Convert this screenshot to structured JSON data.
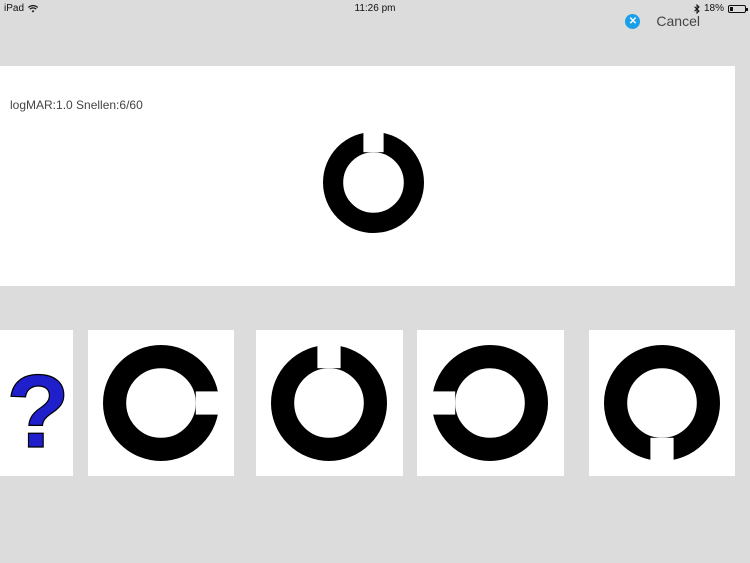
{
  "status_bar": {
    "device": "iPad",
    "time": "11:26 pm",
    "battery_level": "18%",
    "icons": [
      "wifi-icon",
      "bluetooth-icon",
      "battery-icon"
    ]
  },
  "header": {
    "cancel_icon": "close-circle-icon",
    "cancel_label": "Cancel",
    "accent_color": "#1a9fe8"
  },
  "display": {
    "acuity_label": "logMAR:1.0 Snellen:6/60",
    "target_gap_direction": "up"
  },
  "choices": {
    "help_symbol": "?",
    "help_color": "#1f1fcc",
    "options": [
      {
        "gap_direction": "right"
      },
      {
        "gap_direction": "up"
      },
      {
        "gap_direction": "left"
      },
      {
        "gap_direction": "down"
      }
    ]
  }
}
